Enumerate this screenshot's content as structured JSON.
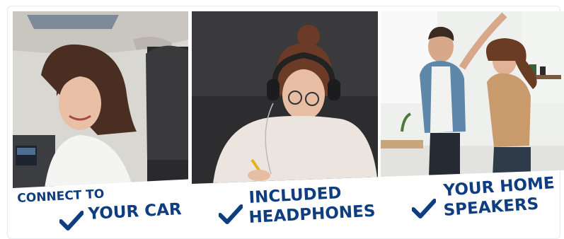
{
  "panels": [
    {
      "line1": "CONNECT TO",
      "line2": "YOUR CAR"
    },
    {
      "line1": "INCLUDED",
      "line2": "HEADPHONES"
    },
    {
      "line1": "YOUR HOME",
      "line2": "SPEAKERS"
    }
  ],
  "colors": {
    "caption_text": "#0e3d80",
    "checkmark": "#0e3d80",
    "background": "#ffffff"
  },
  "icons": [
    "check-icon",
    "check-icon",
    "check-icon"
  ]
}
